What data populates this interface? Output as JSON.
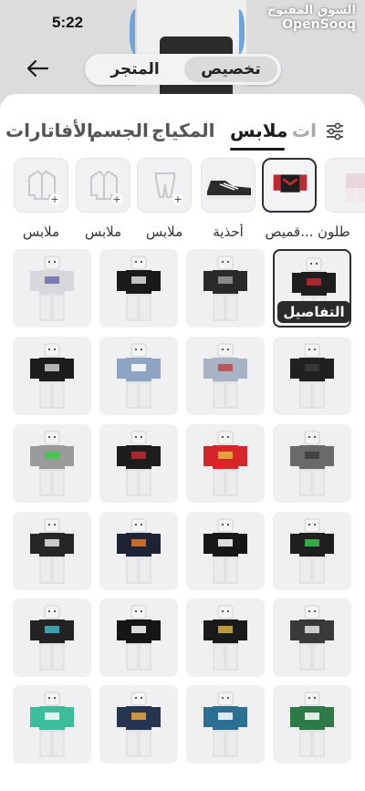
{
  "status_bar": {
    "time": "5:22"
  },
  "watermark": {
    "arabic": "السوق المفتوح",
    "english": "OpenSooq"
  },
  "header": {
    "back_icon": "arrow-left-icon",
    "segments": [
      {
        "label": "تخصيص",
        "active": true
      },
      {
        "label": "المتجر",
        "active": false
      }
    ]
  },
  "tabs": {
    "filter_icon": "sliders-icon",
    "items": [
      {
        "label": "ات",
        "state": "partial"
      },
      {
        "label": "ملابس",
        "state": "active"
      },
      {
        "label": "المكياج",
        "state": "normal"
      },
      {
        "label": "الجسم",
        "state": "normal"
      },
      {
        "label": "الأفاتارات",
        "state": "normal"
      }
    ]
  },
  "categories": [
    {
      "label": "طلون",
      "icon": "pants-shirt-icon"
    },
    {
      "label": "قميص...",
      "icon": "red-shirt-icon",
      "selected": true
    },
    {
      "label": "أحذية",
      "icon": "shoe-icon"
    },
    {
      "label": "ملابس",
      "icon": "pants-add-icon"
    },
    {
      "label": "ملابس",
      "icon": "jacket-add-icon"
    },
    {
      "label": "ملابس",
      "icon": "shirt-add-icon"
    }
  ],
  "grid": {
    "details_label": "التفاصيل",
    "items": [
      {
        "name": "shirt-red-black",
        "torso": "#1e1e1e",
        "accent": "#c3272f",
        "selected": true
      },
      {
        "name": "shirt-black-stripes",
        "torso": "#2a2a2a",
        "accent": "#9a9a9a"
      },
      {
        "name": "shirt-black-graffiti",
        "torso": "#1a1a1a",
        "accent": "#e0e0e0"
      },
      {
        "name": "shirt-white-logo",
        "torso": "#d8d8dc",
        "accent": "#6b6bb0"
      },
      {
        "name": "shirt-black-plain",
        "torso": "#202020",
        "accent": "#3b3b3b"
      },
      {
        "name": "shirt-denim",
        "torso": "#a7b4c6",
        "accent": "#c04848"
      },
      {
        "name": "shirt-blue-shield",
        "torso": "#8ea4c4",
        "accent": "#ffffff"
      },
      {
        "name": "shirt-black-skull",
        "torso": "#1c1c1c",
        "accent": "#d0d0d0"
      },
      {
        "name": "shirt-grey-fur",
        "torso": "#6a6a6a",
        "accent": "#3c3c3c"
      },
      {
        "name": "shirt-red",
        "torso": "#d6262a",
        "accent": "#e7b63a"
      },
      {
        "name": "shirt-black-red",
        "torso": "#1d1d1d",
        "accent": "#c3272f"
      },
      {
        "name": "shirt-grey-green",
        "torso": "#9a9a9a",
        "accent": "#3fc94a"
      },
      {
        "name": "shirt-black-green",
        "torso": "#1f1f1f",
        "accent": "#39c450"
      },
      {
        "name": "shirt-black-small-logo",
        "torso": "#171717",
        "accent": "#ffffff"
      },
      {
        "name": "shirt-navy-pattern",
        "torso": "#1e2436",
        "accent": "#e07a2a"
      },
      {
        "name": "shirt-black-print",
        "torso": "#262626",
        "accent": "#e8e8e8"
      },
      {
        "name": "shirt-black-print-2",
        "torso": "#3a3a3a",
        "accent": "#e8e8e8"
      },
      {
        "name": "shirt-black-chain",
        "torso": "#1a1a1a",
        "accent": "#d9b23a"
      },
      {
        "name": "shirt-black-tee",
        "torso": "#161616",
        "accent": "#ffffff"
      },
      {
        "name": "shirt-black-teal",
        "torso": "#232323",
        "accent": "#3fb5c7"
      },
      {
        "name": "shirt-green-jersey",
        "torso": "#2d7a48",
        "accent": "#ffffff"
      },
      {
        "name": "shirt-blue-jersey",
        "torso": "#2b6f92",
        "accent": "#ffffff"
      },
      {
        "name": "shirt-navy-logo",
        "torso": "#26344f",
        "accent": "#e6a63a"
      },
      {
        "name": "shirt-teal-jersey",
        "torso": "#3bbd9b",
        "accent": "#ffffff"
      }
    ]
  },
  "colors": {
    "selected_border": "#2d2d30",
    "tile_bg": "#f0f0f2",
    "badge_bg": "#2a2a2a"
  }
}
